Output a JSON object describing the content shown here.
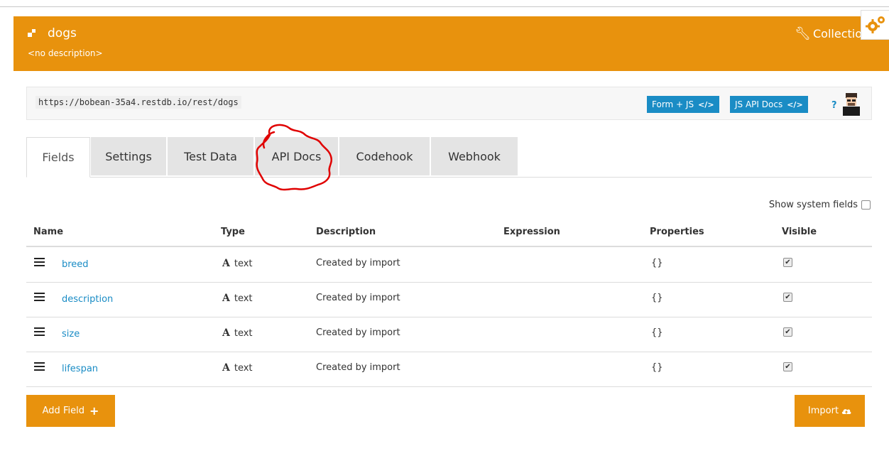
{
  "header": {
    "collection_name": "dogs",
    "description": "<no description>",
    "collection_link": "Collectio",
    "icon": "collection-icon"
  },
  "url_bar": {
    "url": "https://bobean-35a4.restdb.io/rest/dogs",
    "form_js_label": "Form + JS",
    "api_docs_label": "JS API Docs",
    "code_glyph": "</>",
    "help_label": "?"
  },
  "tabs": [
    {
      "label": "Fields",
      "active": true
    },
    {
      "label": "Settings"
    },
    {
      "label": "Test Data"
    },
    {
      "label": "API Docs"
    },
    {
      "label": "Codehook"
    },
    {
      "label": "Webhook"
    }
  ],
  "show_system_fields": {
    "label": "Show system fields",
    "checked": false
  },
  "table": {
    "columns": [
      "Name",
      "Type",
      "Description",
      "Expression",
      "Properties",
      "Visible"
    ],
    "rows": [
      {
        "name": "breed",
        "type": "text",
        "type_icon": "A",
        "description": "Created by import",
        "expression": "",
        "properties": "{}",
        "visible": true
      },
      {
        "name": "description",
        "type": "text",
        "type_icon": "A",
        "description": "Created by import",
        "expression": "",
        "properties": "{}",
        "visible": true
      },
      {
        "name": "size",
        "type": "text",
        "type_icon": "A",
        "description": "Created by import",
        "expression": "",
        "properties": "{}",
        "visible": true
      },
      {
        "name": "lifespan",
        "type": "text",
        "type_icon": "A",
        "description": "Created by import",
        "expression": "",
        "properties": "{}",
        "visible": true
      }
    ]
  },
  "actions": {
    "add_field_label": "Add Field",
    "add_field_icon": "+",
    "import_label": "Import",
    "import_icon": "cloud-upload-icon"
  },
  "colors": {
    "brand_orange": "#e8920d",
    "link_blue": "#1a8cc5",
    "annotation_red": "#e00000"
  }
}
